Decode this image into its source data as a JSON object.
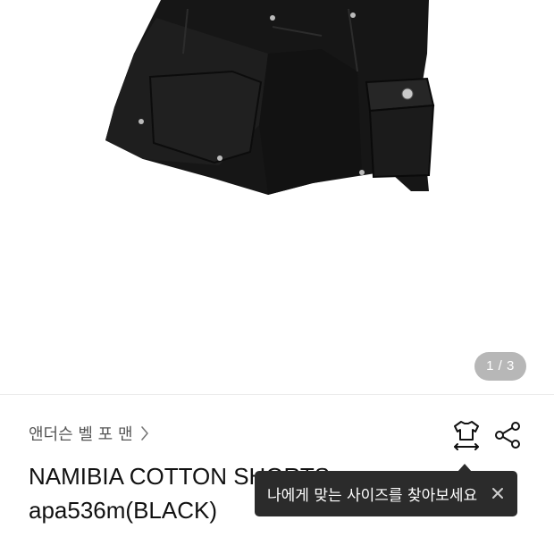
{
  "gallery": {
    "page_indicator": "1 / 3"
  },
  "product": {
    "brand": "앤더슨 벨 포 맨",
    "title_line1": "NAMIBIA COTTON SHORTS",
    "title_line2": "apa536m(BLACK)"
  },
  "tooltip": {
    "text": "나에게 맞는 사이즈를 찾아보세요"
  },
  "icons": {
    "brand_chevron": "chevron-right-icon",
    "size": "shirt-size-icon",
    "share": "share-icon",
    "close": "close-icon"
  },
  "colors": {
    "tooltip_bg": "#2b2b2b",
    "indicator_bg": "#aaaaaa",
    "product_black": "#151515"
  }
}
